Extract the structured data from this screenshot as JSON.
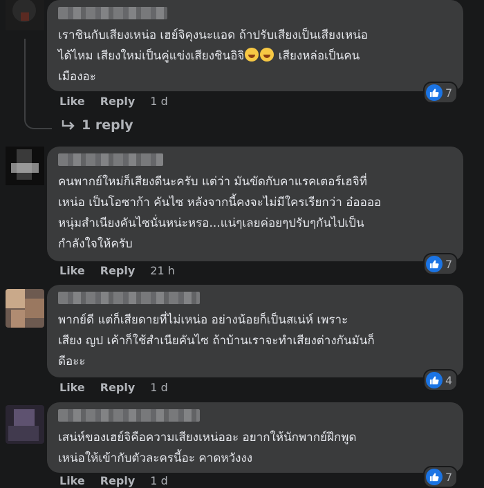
{
  "comments": [
    {
      "text": "เราชินกับเสียงเหน่อ เฮย์จิคุงนะแอด ถ้าปรับเสียงเป็นเสียงเหน่อ\nได้ไหม เสียงใหม่เป็นคู่แข่งเสียงชินอิจิ",
      "text_tail": " เสียงหล่อเป็นคน\nเมืองอะ",
      "emoji_icons": [
        "laughing-face-icon",
        "laughing-face-icon"
      ],
      "reaction_count": "7",
      "like_label": "Like",
      "reply_label": "Reply",
      "time": "1 d",
      "replies_label": "1 reply"
    },
    {
      "text": "คนพากย์ใหม่ก็เสียงดีนะครับ แต่ว่า มันขัดกับคาแรคเตอร์เฮจิที่\nเหน่อ เป็นโอซาก้า คันไซ หลังจากนี้คงจะไม่มีใครเรียกว่า อ๋ออออ\nหนุ่มสำเนียงคันไซนั่นหน่ะหรอ...แน่ๆเลยค่อยๆปรับๆกันไปเป็น\nกำลังใจให้ครับ",
      "reaction_count": "7",
      "like_label": "Like",
      "reply_label": "Reply",
      "time": "21 h"
    },
    {
      "text": "พากย์ดี แต่ก็เสียดายที่ไม่เหน่อ อย่างน้อยก็เป็นสเน่ห์ เพราะ\nเสียง ญป เค้าก็ใช้สำเนียคันไซ ถ้าบ้านเราจะทำเสียงต่างกันมันก็\nดีอะะ",
      "reaction_count": "4",
      "like_label": "Like",
      "reply_label": "Reply",
      "time": "1 d"
    },
    {
      "text": "เสน่ห์ของเฮย์จิคือความเสียงเหน่ออะ อยากให้นักพากย์ฝึกพูด\nเหน่อให้เข้ากับตัวละครนี้อะ คาดหวังงง",
      "reaction_count": "7",
      "like_label": "Like",
      "reply_label": "Reply",
      "time": "1 d"
    }
  ],
  "colors": {
    "background": "#18191a",
    "bubble": "#3a3b3c",
    "text": "#e4e6eb",
    "muted": "#b0b3b8",
    "like_blue": "#1b74e4"
  },
  "icons": [
    "thumbs-up-icon",
    "reply-arrow-icon",
    "laughing-face-icon"
  ]
}
